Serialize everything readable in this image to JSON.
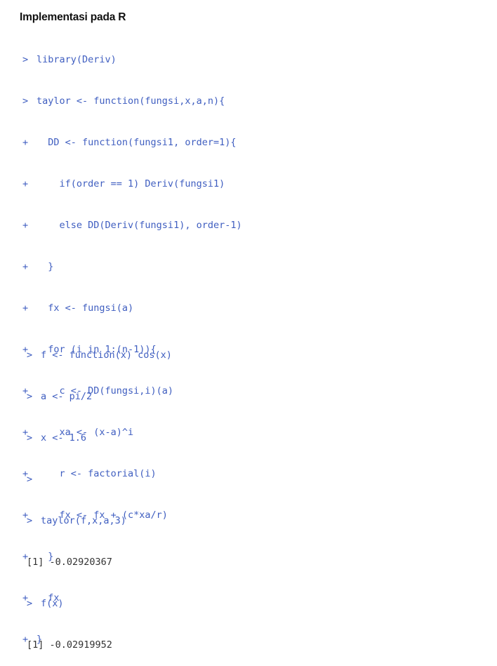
{
  "heading": "Implementasi pada R",
  "code_block_1": [
    {
      "prompt": ">",
      "code": "library(Deriv)"
    },
    {
      "prompt": ">",
      "code": "taylor <- function(fungsi,x,a,n){"
    },
    {
      "prompt": "+",
      "code": "  DD <- function(fungsi1, order=1){"
    },
    {
      "prompt": "+",
      "code": "    if(order == 1) Deriv(fungsi1)"
    },
    {
      "prompt": "+",
      "code": "    else DD(Deriv(fungsi1), order-1)"
    },
    {
      "prompt": "+",
      "code": "  }"
    },
    {
      "prompt": "+",
      "code": "  fx <- fungsi(a)"
    },
    {
      "prompt": "+",
      "code": "  for (i in 1:(n-1)){"
    },
    {
      "prompt": "+",
      "code": "    c <- DD(fungsi,i)(a)"
    },
    {
      "prompt": "+",
      "code": "    xa <- (x-a)^i"
    },
    {
      "prompt": "+",
      "code": "    r <- factorial(i)"
    },
    {
      "prompt": "+",
      "code": "    fx <- fx + (c*xa/r)"
    },
    {
      "prompt": "+",
      "code": "  }"
    },
    {
      "prompt": "+",
      "code": "  fx"
    },
    {
      "prompt": "+",
      "code": "}"
    }
  ],
  "code_block_2": [
    {
      "prompt": ">",
      "code": "f <- function(x) cos(x)",
      "kind": "code"
    },
    {
      "prompt": ">",
      "code": "a <- pi/2",
      "kind": "code"
    },
    {
      "prompt": ">",
      "code": "x <- 1.6",
      "kind": "code"
    },
    {
      "prompt": ">",
      "code": "",
      "kind": "code"
    },
    {
      "prompt": ">",
      "code": "taylor(f,x,a,3)",
      "kind": "code"
    },
    {
      "prompt": "",
      "code": "[1] -0.02920367",
      "kind": "out"
    },
    {
      "prompt": ">",
      "code": "f(x)",
      "kind": "code"
    },
    {
      "prompt": "",
      "code": "[1] -0.02919952",
      "kind": "out"
    }
  ]
}
